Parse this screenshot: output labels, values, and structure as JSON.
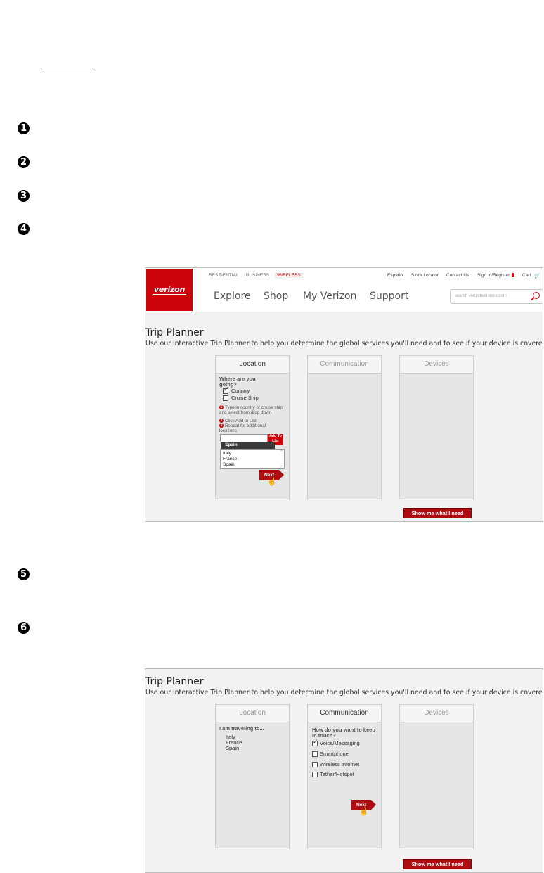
{
  "steps": [
    "1",
    "2",
    "3",
    "4",
    "5",
    "6"
  ],
  "screenshot1": {
    "logo_text": "verizon",
    "segments": [
      "RESIDENTIAL",
      "BUSINESS",
      "WIRELESS"
    ],
    "utility_links": [
      "Español",
      "Store Locator",
      "Contact Us",
      "Sign In/Register",
      "Cart"
    ],
    "main_nav": [
      "Explore",
      "Shop",
      "My Verizon",
      "Support"
    ],
    "search_placeholder": "search verizonwireless.com",
    "title": "Trip Planner",
    "description": "Use our interactive Trip Planner to help you determine the global services you'll need and to see if your device is covered.",
    "panels": [
      "Location",
      "Communication",
      "Devices"
    ],
    "location": {
      "question": "Where are you going?",
      "options": [
        {
          "label": "Country",
          "checked": true
        },
        {
          "label": "Cruise Ship",
          "checked": false
        }
      ],
      "instructions": [
        "Type in country or cruise ship and select from drop down",
        "Click Add to List",
        "Repeat for additional locations"
      ],
      "add_button": "Add To List",
      "dropdown_suggestion": "Spain",
      "list": [
        "Italy",
        "France",
        "Spain"
      ],
      "next": "Next"
    },
    "show_button": "Show me what I need"
  },
  "screenshot2": {
    "title": "Trip Planner",
    "description": "Use our interactive Trip Planner to help you determine the global services you'll need and to see if your device is covered.",
    "panels": [
      "Location",
      "Communication",
      "Devices"
    ],
    "location": {
      "heading": "I am traveling to...",
      "list": [
        "Italy",
        "France",
        "Spain"
      ]
    },
    "communication": {
      "question": "How do you want to keep in touch?",
      "options": [
        {
          "label": "Voice/Messaging",
          "checked": true
        },
        {
          "label": "Smartphone",
          "checked": false
        },
        {
          "label": "Wireless Internet",
          "checked": false
        },
        {
          "label": "Tether/Hotspot",
          "checked": false
        }
      ],
      "next": "Next"
    },
    "show_button": "Show me what I need"
  }
}
